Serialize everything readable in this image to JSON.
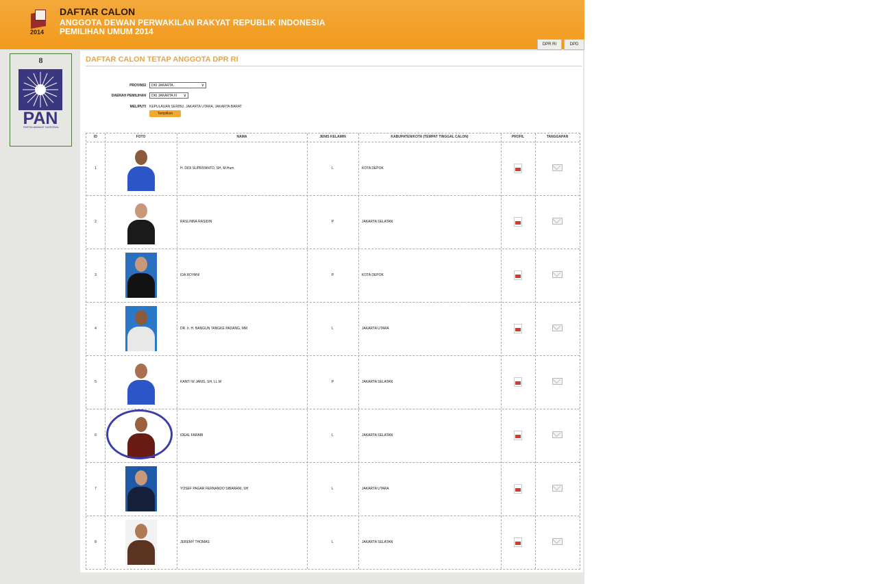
{
  "header": {
    "logo_year": "2014",
    "title": "DAFTAR CALON",
    "subtitle": "ANGGOTA DEWAN PERWAKILAN RAKYAT REPUBLIK INDONESIA",
    "election": "PEMILIHAN UMUM 2014",
    "buttons": [
      "DPR RI",
      "DPD"
    ]
  },
  "party": {
    "number": "8",
    "acronym": "PAN",
    "full_name": "PARTAI AMANAT NASIONAL"
  },
  "main": {
    "section_title": "DAFTAR CALON TETAP ANGGOTA DPR RI",
    "filters": {
      "provinsi_label": "PROVINSI",
      "provinsi_value": "DKI JAKARTA",
      "dapil_label": "DAERAH PEMILIHAN",
      "dapil_value": "DKI JAKARTA III",
      "meliputi_label": "MELIPUTI",
      "meliputi_value": "KEPULAUAN SERIBU, JAKARTA UTARA, JAKARTA BARAT",
      "submit_label": "Tampilkan"
    },
    "table": {
      "headers": [
        "ID",
        "FOTO",
        "NAMA",
        "JENIS KELAMIN",
        "KABUPATEN/KOTA (TEMPAT TINGGAL CALON)",
        "PROFIL",
        "TANGGAPAN"
      ],
      "rows": [
        {
          "id": "1",
          "nama": "H. DIDI SUPRIYANTO, SH, M.Hum",
          "jk": "L",
          "kota": "KOTA DEPOK"
        },
        {
          "id": "2",
          "nama": "RASLINNA RASIDIN",
          "jk": "P",
          "kota": "JAKARTA SELATAN"
        },
        {
          "id": "3",
          "nama": "IDA ROYANI",
          "jk": "P",
          "kota": "KOTA DEPOK"
        },
        {
          "id": "4",
          "nama": "DR. Ir. H. BANGUN TANGKE PADANG, MM",
          "jk": "L",
          "kota": "JAKARTA UTARA"
        },
        {
          "id": "5",
          "nama": "KANTI W JANIS, SH, LL.M",
          "jk": "P",
          "kota": "JAKARTA SELATAN"
        },
        {
          "id": "6",
          "nama": "IDEAL FARABI",
          "jk": "L",
          "kota": "JAKARTA SELATAN"
        },
        {
          "id": "7",
          "nama": "YOSEF PAGAR FERNANDO SIBARANI, SH",
          "jk": "L",
          "kota": "JAKARTA UTARA"
        },
        {
          "id": "8",
          "nama": "JEREMY THOMAS",
          "jk": "L",
          "kota": "JAKARTA SELATAN"
        }
      ]
    }
  },
  "colors": {
    "header_orange": "#f19a1c",
    "section_title": "#e8a542",
    "party_blue": "#3a3680",
    "highlight_ring": "#3b3ea8"
  }
}
